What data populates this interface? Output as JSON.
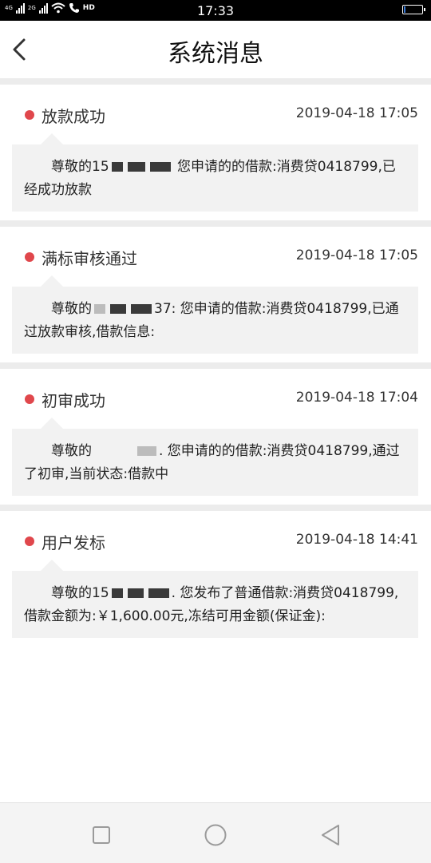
{
  "status_bar": {
    "network_top": "4G",
    "network_bottom": "2G",
    "hd_label": "HD",
    "time": "17:33",
    "battery_level": 0.1,
    "accent_color": "#3a7ad6"
  },
  "header": {
    "title": "系统消息",
    "back_icon": "chevron-left-icon"
  },
  "messages": [
    {
      "title": "放款成功",
      "time": "2019-04-18 17:05",
      "pre": "尊敬的15",
      "post": " 您申请的的借款:消费贷0418799,已经成功放款"
    },
    {
      "title": "满标审核通过",
      "time": "2019-04-18 17:05",
      "pre": "尊敬的",
      "post": "37: 您申请的借款:消费贷0418799,已通过放款审核,借款信息:"
    },
    {
      "title": "初审成功",
      "time": "2019-04-18 17:04",
      "pre": "尊敬的",
      "post": ". 您申请的的借款:消费贷0418799,通过了初审,当前状态:借款中"
    },
    {
      "title": "用户发标",
      "time": "2019-04-18 14:41",
      "pre": "尊敬的15",
      "post": ". 您发布了普通借款:消费贷0418799,借款金额为:￥1,600.00元,冻结可用金额(保证金):"
    }
  ],
  "colors": {
    "unread_dot": "#e0474c",
    "bubble_bg": "#f2f2f2",
    "separator": "#ececec"
  },
  "nav_bar": {
    "recents_icon": "square-icon",
    "home_icon": "circle-icon",
    "back_icon": "triangle-back-icon"
  }
}
